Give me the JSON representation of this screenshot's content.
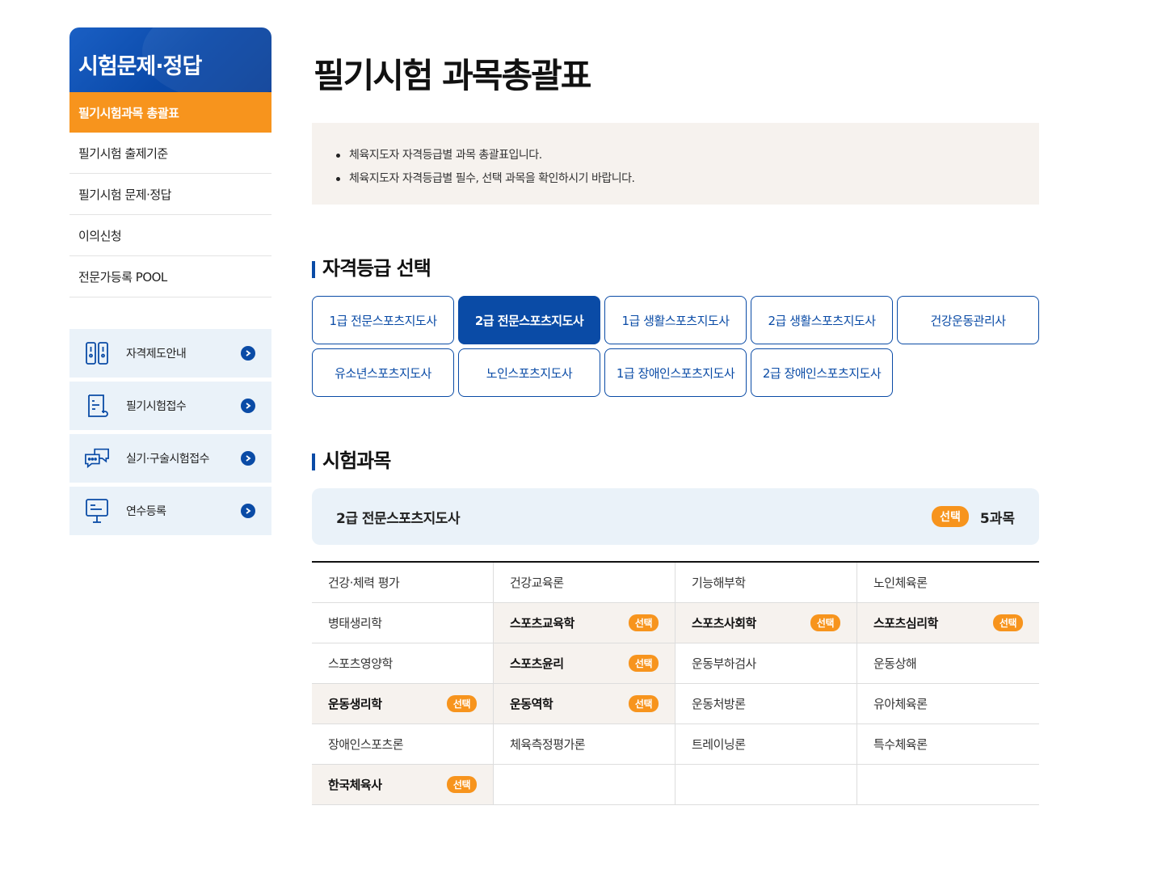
{
  "sidebar": {
    "title": "시험문제·정답",
    "menu": [
      {
        "label": "필기시험과목 총괄표",
        "active": true
      },
      {
        "label": "필기시험 출제기준",
        "active": false
      },
      {
        "label": "필기시험 문제·정답",
        "active": false
      },
      {
        "label": "이의신청",
        "active": false
      },
      {
        "label": "전문가등록 POOL",
        "active": false
      }
    ],
    "quick_links": [
      {
        "label": "자격제도안내",
        "icon": "document-panels-icon"
      },
      {
        "label": "필기시험접수",
        "icon": "scroll-document-icon"
      },
      {
        "label": "실기·구술시험접수",
        "icon": "chat-bubbles-icon"
      },
      {
        "label": "연수등록",
        "icon": "presentation-board-icon"
      }
    ]
  },
  "main": {
    "title": "필기시험 과목총괄표",
    "notices": [
      "체육지도자 자격등급별 과목 총괄표입니다.",
      "체육지도자 자격등급별 필수, 선택 과목을 확인하시기 바랍니다."
    ],
    "grade_section_title": "자격등급 선택",
    "grades": [
      {
        "label": "1급 전문스포츠지도사",
        "active": false
      },
      {
        "label": "2급 전문스포츠지도사",
        "active": true
      },
      {
        "label": "1급 생활스포츠지도사",
        "active": false
      },
      {
        "label": "2급 생활스포츠지도사",
        "active": false
      },
      {
        "label": "건강운동관리사",
        "active": false
      },
      {
        "label": "유소년스포츠지도사",
        "active": false
      },
      {
        "label": "노인스포츠지도사",
        "active": false
      },
      {
        "label": "1급 장애인스포츠지도사",
        "active": false
      },
      {
        "label": "2급 장애인스포츠지도사",
        "active": false
      }
    ],
    "subject_section_title": "시험과목",
    "selected_grade": "2급 전문스포츠지도사",
    "select_label": "선택",
    "subject_count": "5과목",
    "subjects": [
      {
        "name": "건강·체력 평가",
        "selectable": false
      },
      {
        "name": "건강교육론",
        "selectable": false
      },
      {
        "name": "기능해부학",
        "selectable": false
      },
      {
        "name": "노인체육론",
        "selectable": false
      },
      {
        "name": "병태생리학",
        "selectable": false
      },
      {
        "name": "스포츠교육학",
        "selectable": true
      },
      {
        "name": "스포츠사회학",
        "selectable": true
      },
      {
        "name": "스포츠심리학",
        "selectable": true
      },
      {
        "name": "스포츠영양학",
        "selectable": false
      },
      {
        "name": "스포츠윤리",
        "selectable": true
      },
      {
        "name": "운동부하검사",
        "selectable": false
      },
      {
        "name": "운동상해",
        "selectable": false
      },
      {
        "name": "운동생리학",
        "selectable": true
      },
      {
        "name": "운동역학",
        "selectable": true
      },
      {
        "name": "운동처방론",
        "selectable": false
      },
      {
        "name": "유아체육론",
        "selectable": false
      },
      {
        "name": "장애인스포츠론",
        "selectable": false
      },
      {
        "name": "체육측정평가론",
        "selectable": false
      },
      {
        "name": "트레이닝론",
        "selectable": false
      },
      {
        "name": "특수체육론",
        "selectable": false
      },
      {
        "name": "한국체육사",
        "selectable": true
      },
      {
        "name": "",
        "selectable": false
      },
      {
        "name": "",
        "selectable": false
      },
      {
        "name": "",
        "selectable": false
      }
    ],
    "badge_label": "선택"
  },
  "colors": {
    "primary_blue": "#0a4ba6",
    "accent_orange": "#f7941d",
    "light_blue_bg": "#eaf2f9",
    "beige_bg": "#f6f2ee"
  }
}
